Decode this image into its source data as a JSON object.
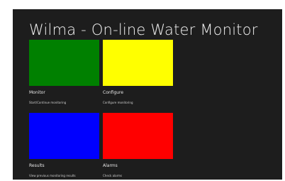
{
  "app": {
    "title": "Wilma - On-line Water Monitor"
  },
  "tiles": [
    {
      "label": "Monitor",
      "subtitle": "Start/Continue monitoring",
      "color": "#008000"
    },
    {
      "label": "Configure",
      "subtitle": "Configure monitoring",
      "color": "#ffff00"
    },
    {
      "label": "Results",
      "subtitle": "View previous monitoring results",
      "color": "#0000ff"
    },
    {
      "label": "Alarms",
      "subtitle": "Check alarms",
      "color": "#ff0000"
    }
  ],
  "colors": {
    "background": "#1d1d1d",
    "text": "#f2f2f2"
  }
}
